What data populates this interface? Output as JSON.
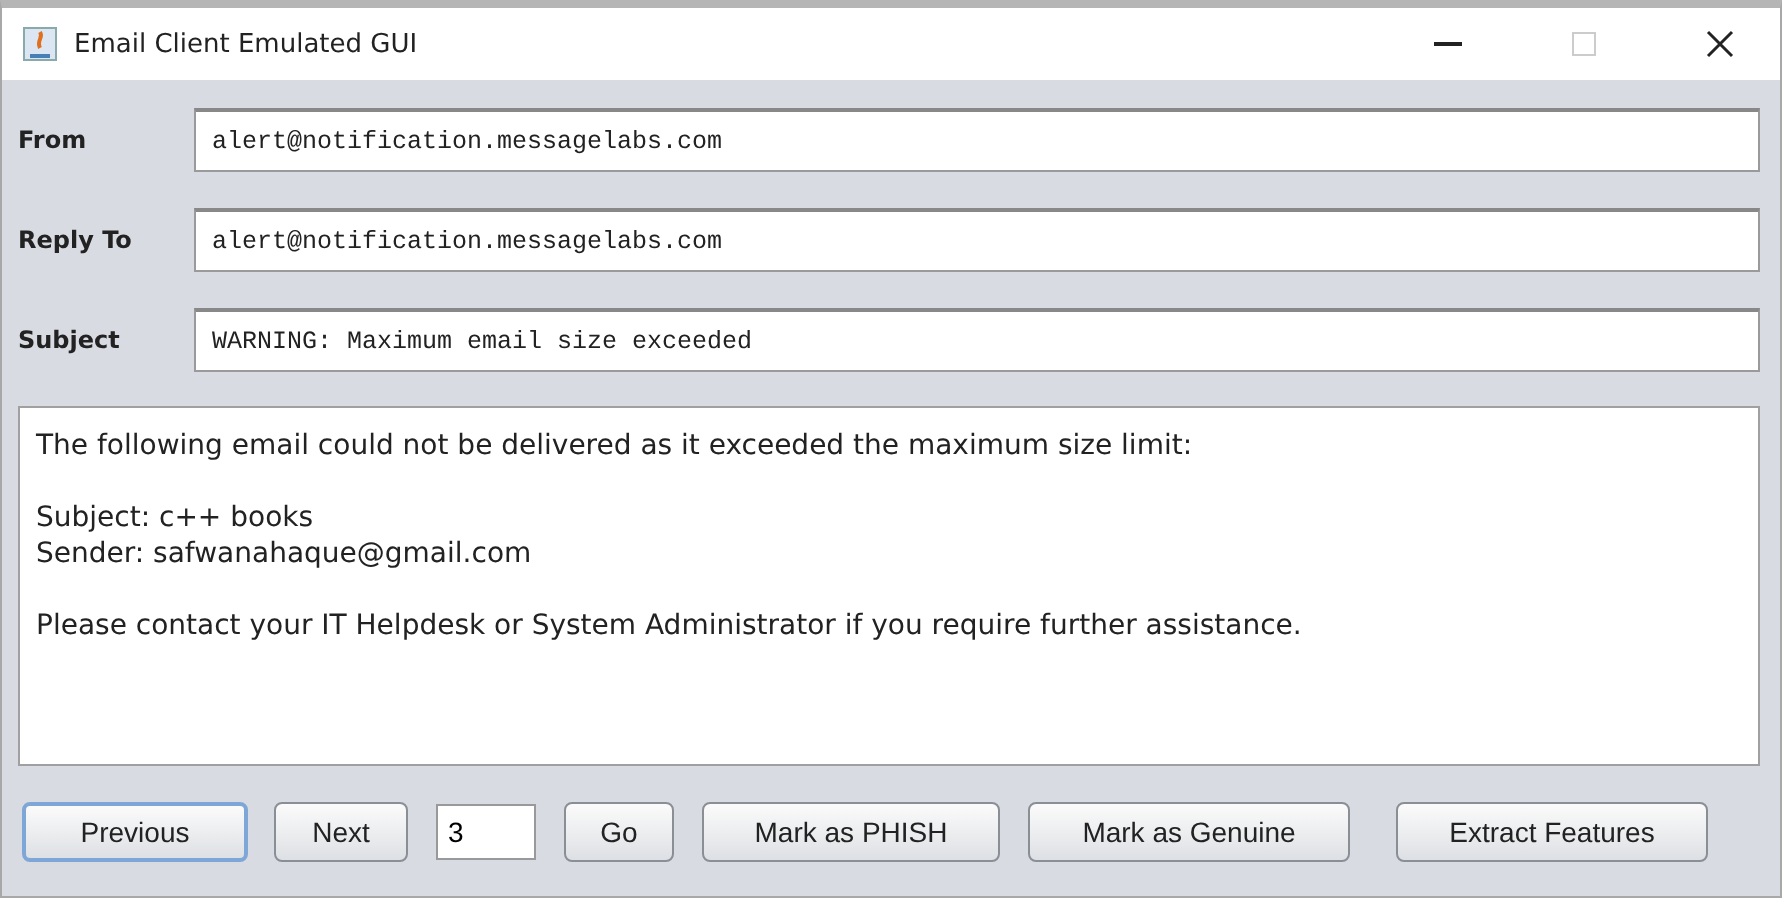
{
  "window": {
    "title": "Email Client Emulated GUI"
  },
  "fields": [
    {
      "label": "From",
      "value": "alert@notification.messagelabs.com"
    },
    {
      "label": "Reply To",
      "value": "alert@notification.messagelabs.com"
    },
    {
      "label": "Subject",
      "value": "WARNING: Maximum email size exceeded"
    }
  ],
  "body": [
    [
      "The following email could not be delivered as it exceeded the maximum size limit:"
    ],
    [
      "Subject: c++ books",
      "Sender: safwanahaque@gmail.com"
    ],
    [
      "Please contact your IT Helpdesk or System Administrator if you require further assistance."
    ]
  ],
  "controls": [
    {
      "kind": "button",
      "label": "Previous",
      "focused": true
    },
    {
      "kind": "button",
      "label": "Next",
      "focused": false
    },
    {
      "kind": "input",
      "value": "3"
    },
    {
      "kind": "button",
      "label": "Go",
      "focused": false
    },
    {
      "kind": "button",
      "label": "Mark as PHISH",
      "focused": false
    },
    {
      "kind": "button",
      "label": "Mark as Genuine",
      "focused": false
    },
    {
      "kind": "button",
      "label": "Extract Features",
      "focused": false
    }
  ]
}
